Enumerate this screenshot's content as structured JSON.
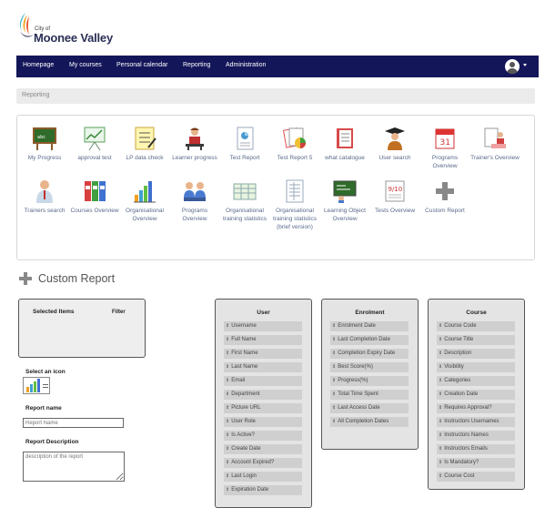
{
  "header": {
    "logo_small": "City of",
    "logo_name": "Moonee Valley"
  },
  "nav": {
    "items": [
      {
        "label": "Homepage"
      },
      {
        "label": "My courses"
      },
      {
        "label": "Personal calendar"
      },
      {
        "label": "Reporting"
      },
      {
        "label": "Administration"
      }
    ]
  },
  "breadcrumb": "Reporting",
  "reports": [
    {
      "label": "My Progress",
      "icon": "blackboard-icon"
    },
    {
      "label": "approval test",
      "icon": "easel-chart-icon"
    },
    {
      "label": "LP data check",
      "icon": "checklist-icon"
    },
    {
      "label": "Learner progress",
      "icon": "learner-icon"
    },
    {
      "label": "Test Report",
      "icon": "document-chart-icon"
    },
    {
      "label": "Test Report 5",
      "icon": "report-pie-icon"
    },
    {
      "label": "what catalogue",
      "icon": "book-icon"
    },
    {
      "label": "User search",
      "icon": "graduate-icon"
    },
    {
      "label": "Programs Overview",
      "icon": "calendar-icon"
    },
    {
      "label": "Trainer's Overview",
      "icon": "trainer-icon"
    },
    {
      "label": "Trainers search",
      "icon": "trainer-person-icon"
    },
    {
      "label": "Courses Overview",
      "icon": "binders-icon"
    },
    {
      "label": "Organisational Overview",
      "icon": "bar-chart-icon"
    },
    {
      "label": "Programs Overview",
      "icon": "group-icon"
    },
    {
      "label": "Organisational training statistics",
      "icon": "spreadsheet-icon"
    },
    {
      "label": "Organisational training statistics (brief version)",
      "icon": "sheet-icon"
    },
    {
      "label": "Learning Object Overview",
      "icon": "learning-board-icon"
    },
    {
      "label": "Tests Overview",
      "icon": "test-score-icon"
    },
    {
      "label": "Custom Report",
      "icon": "plus-icon"
    }
  ],
  "custom_report": {
    "title": "Custom Report",
    "selected_items": "Selected Items",
    "filter": "Filter",
    "select_icon_label": "Select an icon",
    "report_name_label": "Report name",
    "report_name_placeholder": "Report Name",
    "report_desc_label": "Report Description",
    "report_desc_placeholder": "description of the report"
  },
  "columns": [
    {
      "title": "User",
      "fields": [
        "Username",
        "Full Name",
        "First Name",
        "Last Name",
        "Email",
        "Department",
        "Picture URL",
        "User Role",
        "Is Active?",
        "Create Date",
        "Account Expired?",
        "Last Login",
        "Expiration Date"
      ]
    },
    {
      "title": "Enrolment",
      "fields": [
        "Enrolment Date",
        "Last Completion Date",
        "Completion Expiry Date",
        "Best Score(%)",
        "Progress(%)",
        "Total Time Spent",
        "Last Access Date",
        "All Completion Dates"
      ]
    },
    {
      "title": "Course",
      "fields": [
        "Course Code",
        "Course Title",
        "Description",
        "Visibility",
        "Categories",
        "Creation Date",
        "Requires Approval?",
        "Instructors Usernames",
        "Instructors Names",
        "Instructors Emails",
        "Is Mandatory?",
        "Course Cost"
      ]
    }
  ],
  "colors": {
    "navbar": "#14165a",
    "link": "#5a6a8a"
  }
}
